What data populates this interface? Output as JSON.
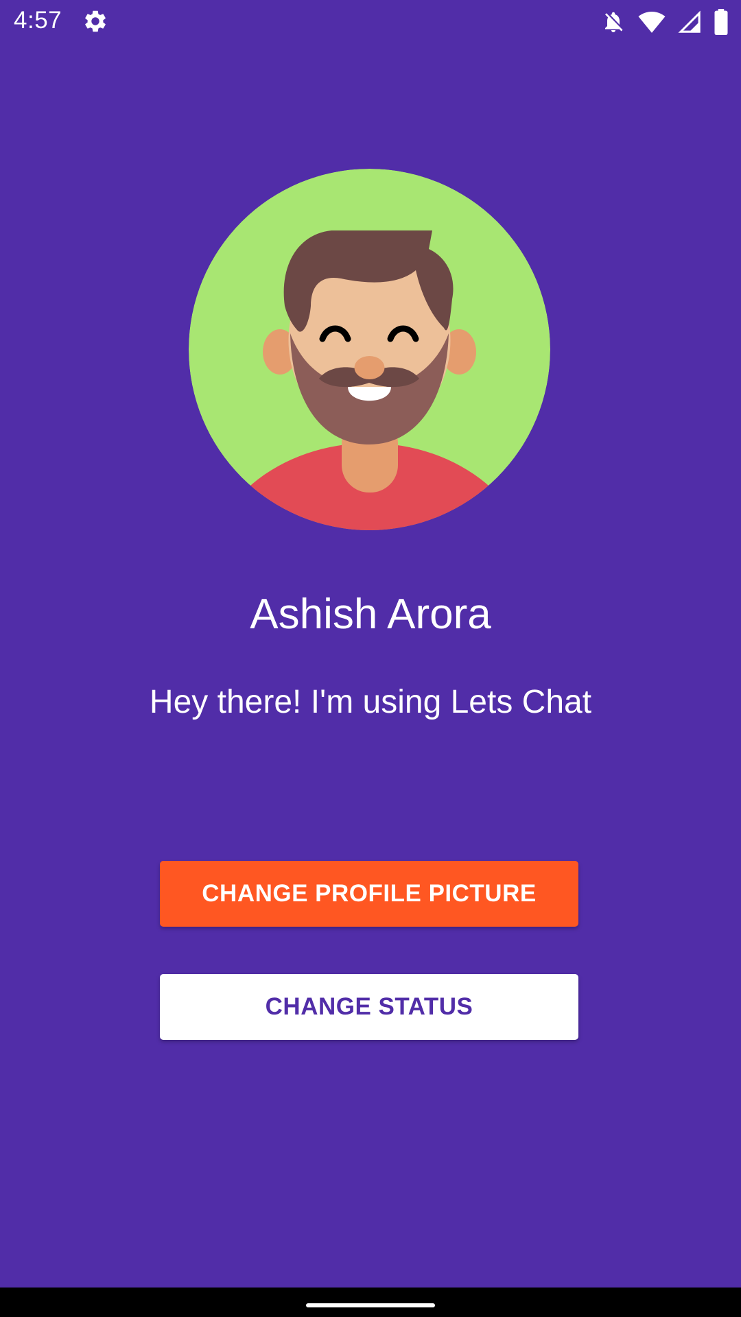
{
  "status_bar": {
    "time": "4:57",
    "icons": [
      "settings-gear-icon",
      "notifications-off-icon",
      "wifi-icon",
      "cell-signal-icon",
      "battery-icon"
    ]
  },
  "profile": {
    "avatar_icon": "avatar-man-beard-icon",
    "name": "Ashish Arora",
    "status": "Hey there! I'm using Lets Chat"
  },
  "actions": {
    "change_picture_label": "CHANGE PROFILE PICTURE",
    "change_status_label": "CHANGE STATUS"
  },
  "colors": {
    "background": "#512DA8",
    "primary_button": "#FF5722",
    "secondary_button": "#FFFFFF",
    "avatar_background": "#A8E672"
  }
}
